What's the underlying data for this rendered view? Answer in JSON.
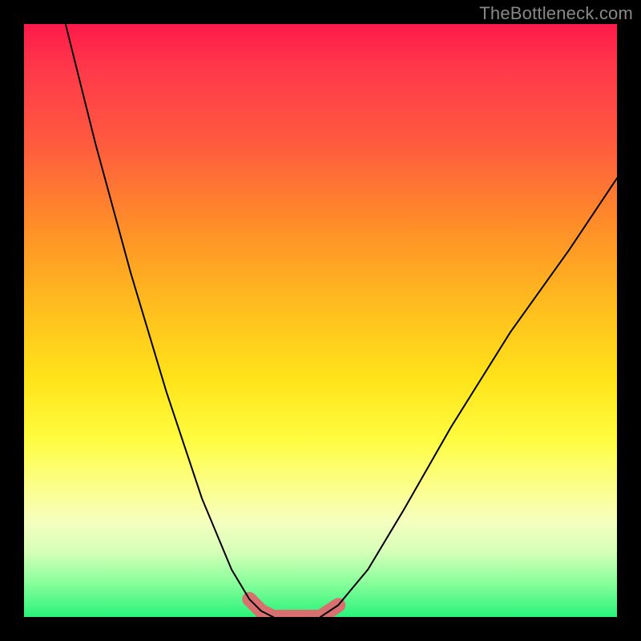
{
  "watermark": "TheBottleneck.com",
  "chart_data": {
    "type": "line",
    "title": "",
    "xlabel": "",
    "ylabel": "",
    "xlim": [
      0,
      100
    ],
    "ylim": [
      0,
      100
    ],
    "grid": false,
    "legend": false,
    "background_gradient": [
      "#ff1a4a",
      "#ff8a2a",
      "#ffe41a",
      "#29f37a"
    ],
    "series": [
      {
        "name": "left-branch",
        "x": [
          7,
          12,
          18,
          24,
          30,
          35,
          38,
          40,
          42
        ],
        "values": [
          100,
          80,
          58,
          38,
          20,
          8,
          3,
          1,
          0
        ]
      },
      {
        "name": "right-branch",
        "x": [
          50,
          53,
          58,
          64,
          72,
          82,
          92,
          100
        ],
        "values": [
          0,
          2,
          8,
          18,
          32,
          48,
          62,
          74
        ]
      }
    ],
    "highlight_region": {
      "name": "optimal-plateau",
      "x": [
        38,
        40,
        42,
        46,
        50,
        53
      ],
      "values": [
        3,
        1,
        0,
        0,
        0,
        2
      ]
    }
  }
}
